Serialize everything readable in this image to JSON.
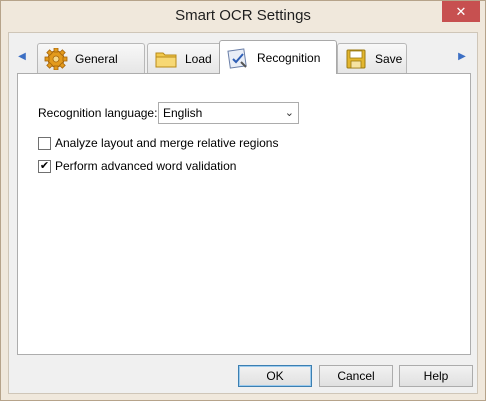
{
  "window": {
    "title": "Smart OCR Settings",
    "close_glyph": "✕"
  },
  "tabs": {
    "scroll_left_icon": "◀",
    "scroll_right_icon": "▶",
    "items": [
      {
        "label": "General",
        "icon": "gear-icon"
      },
      {
        "label": "Load",
        "icon": "folder-icon"
      },
      {
        "label": "Recognition",
        "icon": "recognition-icon",
        "active": true
      },
      {
        "label": "Save",
        "icon": "floppy-icon"
      }
    ]
  },
  "recognition": {
    "language_label": "Recognition language:",
    "language_value": "English",
    "chevron": "⌄",
    "analyze_layout_label": "Analyze layout and merge relative regions",
    "analyze_layout_checked": false,
    "advanced_validation_label": "Perform advanced word validation",
    "advanced_validation_checked": true,
    "check_glyph": "✔"
  },
  "buttons": {
    "ok": "OK",
    "cancel": "Cancel",
    "help": "Help"
  }
}
